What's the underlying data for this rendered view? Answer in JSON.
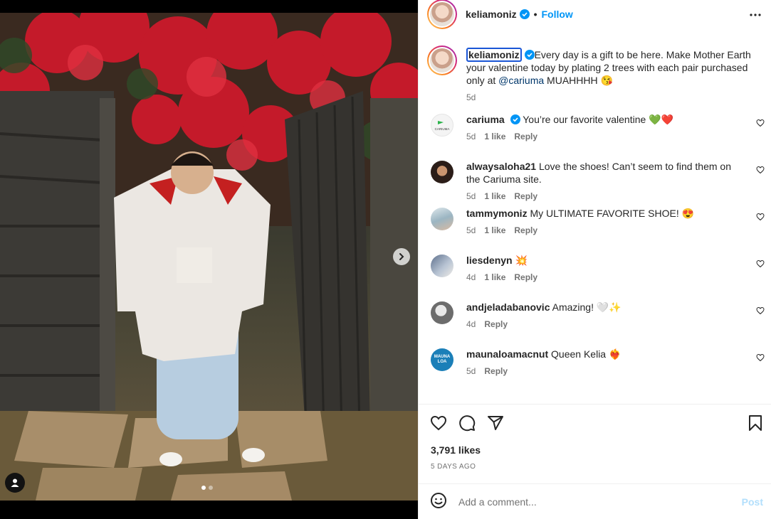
{
  "header": {
    "username": "keliamoniz",
    "separator": "•",
    "follow_label": "Follow"
  },
  "caption": {
    "username": "keliamoniz",
    "text_before": "Every day is a gift to be here. Make Mother Earth your valentine today by plating 2 trees with each pair purchased only at ",
    "mention": "@cariuma",
    "text_after": " MUAHHHH 😘",
    "age": "5d"
  },
  "comments": [
    {
      "username": "cariuma",
      "verified": true,
      "text": "You’re our favorite valentine 💚❤️",
      "age": "5d",
      "likes": "1 like",
      "reply": "Reply",
      "avatar_color": "#f2f2f2"
    },
    {
      "username": "alwaysaloha21",
      "verified": false,
      "text": "Love the shoes! Can’t seem to find them on the Cariuma site.",
      "age": "5d",
      "likes": "1 like",
      "reply": "Reply",
      "avatar_color": "#3b2b26"
    },
    {
      "username": "tammymoniz",
      "verified": false,
      "text": "My ULTIMATE FAVORITE SHOE! 😍",
      "age": "5d",
      "likes": "1 like",
      "reply": "Reply",
      "avatar_color": "#9bb5c2"
    },
    {
      "username": "liesdenyn",
      "verified": false,
      "text": "💥",
      "age": "4d",
      "likes": "1 like",
      "reply": "Reply",
      "avatar_color": "#7f8fa6"
    },
    {
      "username": "andjeladabanovic",
      "verified": false,
      "text": "Amazing! 🤍✨",
      "age": "4d",
      "likes": "",
      "reply": "Reply",
      "avatar_color": "#8a8a8a"
    },
    {
      "username": "maunaloamacnut",
      "verified": false,
      "text": "Queen Kelia ❤️‍🔥",
      "age": "5d",
      "likes": "",
      "reply": "Reply",
      "avatar_color": "#1b7fb8"
    }
  ],
  "cariuma_avatar_text": "CARIUMA",
  "maunaloa_avatar_text": "MAUNA LOA",
  "likes_count": "3,791 likes",
  "posted_time": "5 DAYS AGO",
  "add_comment": {
    "placeholder": "Add a comment...",
    "post_label": "Post"
  },
  "colors": {
    "accent": "#0095f6",
    "post_disabled": "#b2dffc",
    "verified": "#0095f6"
  }
}
